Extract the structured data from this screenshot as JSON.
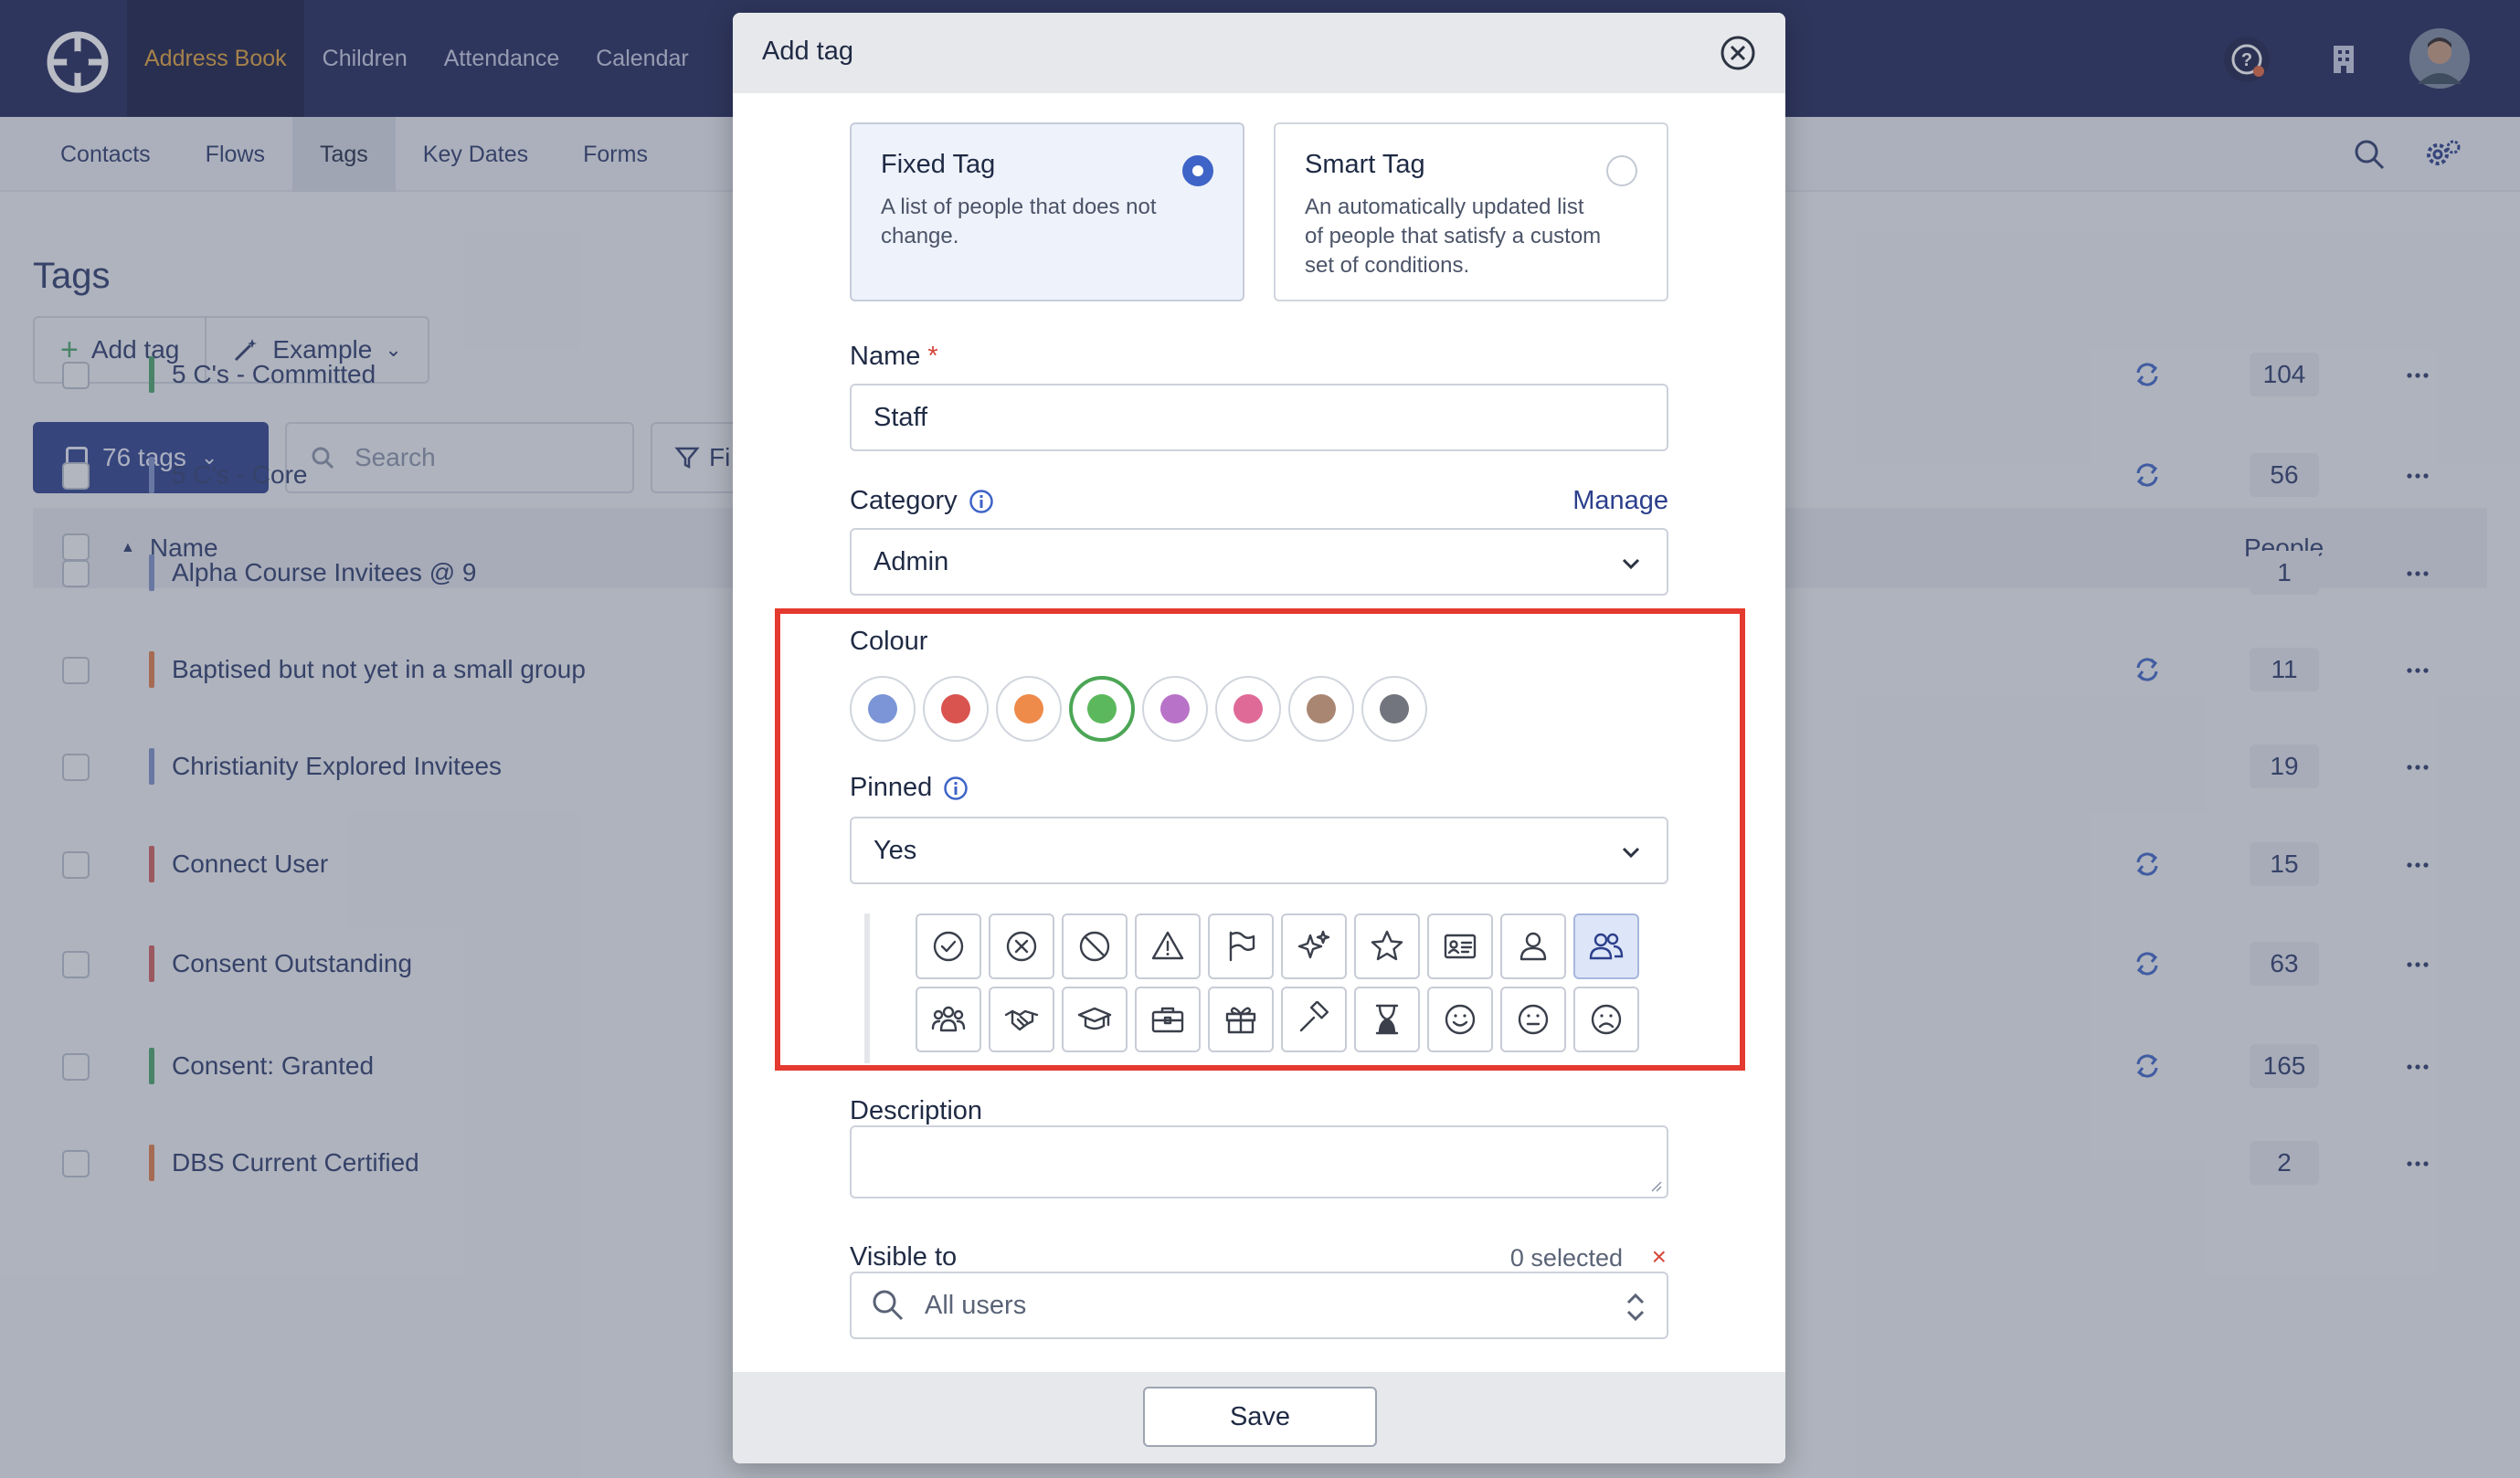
{
  "topnav": {
    "items": [
      "Address Book",
      "Children",
      "Attendance",
      "Calendar"
    ]
  },
  "subnav": {
    "items": [
      "Contacts",
      "Flows",
      "Tags",
      "Key Dates",
      "Forms"
    ]
  },
  "page": {
    "title": "Tags",
    "add_tag_label": "Add tag",
    "example_label": "Example",
    "tag_count_label": "76 tags",
    "search_placeholder": "Search",
    "filter_label": "Fi",
    "col_name": "Name",
    "col_people": "People",
    "rows": [
      {
        "name": "5 C's - Committed",
        "color": "#4ba36b",
        "count": "104",
        "sync": true
      },
      {
        "name": "5 C's - Core",
        "color": "#7d92c9",
        "count": "56",
        "sync": true
      },
      {
        "name": "Alpha Course Invitees @ 9",
        "color": "#7d92c9",
        "count": "1",
        "sync": false
      },
      {
        "name": "Baptised but not yet in a small group",
        "color": "#e07c4a",
        "count": "11",
        "sync": true
      },
      {
        "name": "Christianity Explored Invitees",
        "color": "#7d92c9",
        "count": "19",
        "sync": false
      },
      {
        "name": "Connect User",
        "color": "#d05e5e",
        "count": "15",
        "sync": true
      },
      {
        "name": "Consent Outstanding",
        "color": "#d05e5e",
        "count": "63",
        "sync": true
      },
      {
        "name": "Consent: Granted",
        "color": "#4ba36b",
        "count": "165",
        "sync": true
      },
      {
        "name": "DBS Current Certified",
        "color": "#e07c4a",
        "count": "2",
        "sync": false
      }
    ]
  },
  "modal": {
    "title": "Add tag",
    "fixed": {
      "title": "Fixed Tag",
      "desc": "A list of people that does not change.",
      "selected": true
    },
    "smart": {
      "title": "Smart Tag",
      "desc": "An automatically updated list of people that satisfy a custom set of conditions.",
      "selected": false
    },
    "name_label": "Name",
    "required_mark": "*",
    "name_value": "Staff",
    "category_label": "Category",
    "manage_label": "Manage",
    "category_value": "Admin",
    "colour_label": "Colour",
    "colours": [
      "#7b95d6",
      "#d9534f",
      "#ee8a4a",
      "#5cb85c",
      "#b873c8",
      "#df6a98",
      "#a98672",
      "#72757d"
    ],
    "selected_colour_index": 3,
    "pinned_label": "Pinned",
    "pinned_value": "Yes",
    "icons": [
      "check-circle-icon",
      "x-circle-icon",
      "ban-icon",
      "warning-icon",
      "flag-icon",
      "sparkles-icon",
      "star-icon",
      "id-card-icon",
      "person-icon",
      "people-icon",
      "group-icon",
      "handshake-icon",
      "graduation-cap-icon",
      "briefcase-icon",
      "gift-icon",
      "gavel-icon",
      "hourglass-icon",
      "smile-icon",
      "neutral-face-icon",
      "frown-icon"
    ],
    "selected_icon_index": 9,
    "description_label": "Description",
    "visible_label": "Visible to",
    "selected_count": "0 selected",
    "clear_mark": "×",
    "visible_placeholder": "All users",
    "save_label": "Save"
  },
  "colors": {
    "navy": "#21285a",
    "accent": "#e0a23c",
    "primary": "#2c3f8c",
    "highlight": "#e53a2f"
  }
}
